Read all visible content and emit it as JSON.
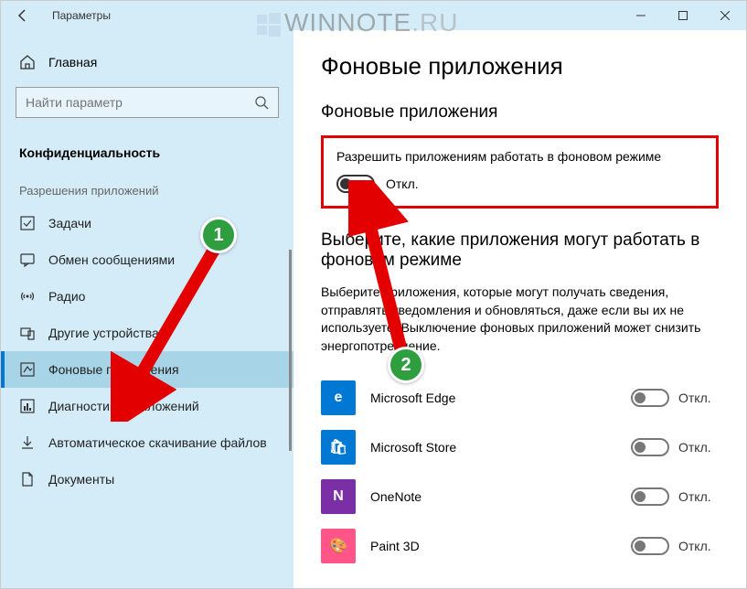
{
  "window": {
    "title": "Параметры"
  },
  "watermark": {
    "text1": "WINNOTE",
    "text2": ".RU"
  },
  "sidebar": {
    "home": "Главная",
    "search_placeholder": "Найти параметр",
    "category": "Конфиденциальность",
    "section": "Разрешения приложений",
    "items": [
      {
        "label": "Задачи"
      },
      {
        "label": "Обмен сообщениями"
      },
      {
        "label": "Радио"
      },
      {
        "label": "Другие устройства"
      },
      {
        "label": "Фоновые приложения"
      },
      {
        "label": "Диагностика приложений"
      },
      {
        "label": "Автоматическое скачивание файлов"
      },
      {
        "label": "Документы"
      }
    ]
  },
  "content": {
    "page_title": "Фоновые приложения",
    "section1_title": "Фоновые приложения",
    "main_setting": "Разрешить приложениям работать в фоновом режиме",
    "main_state": "Откл.",
    "section2_title": "Выберите, какие приложения могут работать в фоновом режиме",
    "description": "Выберите приложения, которые могут получать сведения, отправлять уведомления и обновляться, даже если вы их не используете. Выключение фоновых приложений может снизить энергопотребление.",
    "apps": [
      {
        "name": "Microsoft Edge",
        "state": "Откл.",
        "color": "#0078d4"
      },
      {
        "name": "Microsoft Store",
        "state": "Откл.",
        "color": "#0078d4"
      },
      {
        "name": "OneNote",
        "state": "Откл.",
        "color": "#7b2fa6"
      },
      {
        "name": "Paint 3D",
        "state": "Откл.",
        "color": "#ff5588"
      }
    ]
  },
  "annotations": {
    "badge1": "1",
    "badge2": "2"
  }
}
